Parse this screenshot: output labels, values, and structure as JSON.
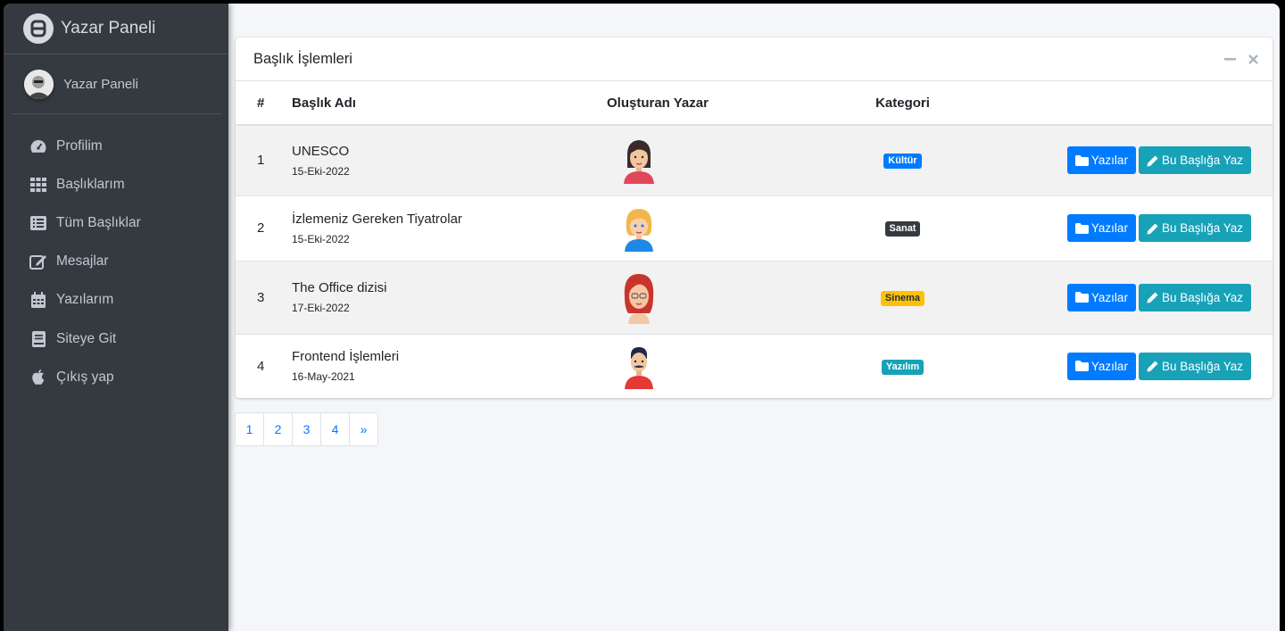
{
  "sidebar": {
    "brand": "Yazar Paneli",
    "user_name": "Yazar Paneli",
    "items": [
      {
        "label": "Profilim",
        "icon": "tachometer-icon"
      },
      {
        "label": "Başlıklarım",
        "icon": "grid-icon"
      },
      {
        "label": "Tüm Başlıklar",
        "icon": "list-alt-icon"
      },
      {
        "label": "Mesajlar",
        "icon": "edit-icon"
      },
      {
        "label": "Yazılarım",
        "icon": "calendar-icon"
      },
      {
        "label": "Siteye Git",
        "icon": "book-icon"
      },
      {
        "label": "Çıkış yap",
        "icon": "apple-icon"
      }
    ]
  },
  "card": {
    "title": "Başlık İşlemleri",
    "columns": [
      "#",
      "Başlık Adı",
      "Oluşturan Yazar",
      "Kategori",
      ""
    ],
    "rows": [
      {
        "num": "1",
        "title": "UNESCO",
        "date": "15-Eki-2022",
        "category": "Kültür",
        "category_color": "#007bff",
        "avatar": "woman-dark-hair-avatar"
      },
      {
        "num": "2",
        "title": "İzlemeniz Gereken Tiyatrolar",
        "date": "15-Eki-2022",
        "category": "Sanat",
        "category_color": "#343a40",
        "avatar": "woman-blonde-avatar"
      },
      {
        "num": "3",
        "title": "The Office dizisi",
        "date": "17-Eki-2022",
        "category": "Sinema",
        "category_color": "#ffc107",
        "avatar": "woman-red-hair-avatar"
      },
      {
        "num": "4",
        "title": "Frontend İşlemleri",
        "date": "16-May-2021",
        "category": "Yazılım",
        "category_color": "#17a2b8",
        "avatar": "man-mustache-avatar"
      }
    ],
    "btn_posts": "Yazılar",
    "btn_write": "Bu Başlığa Yaz"
  },
  "pagination": [
    "1",
    "2",
    "3",
    "4",
    "»"
  ]
}
